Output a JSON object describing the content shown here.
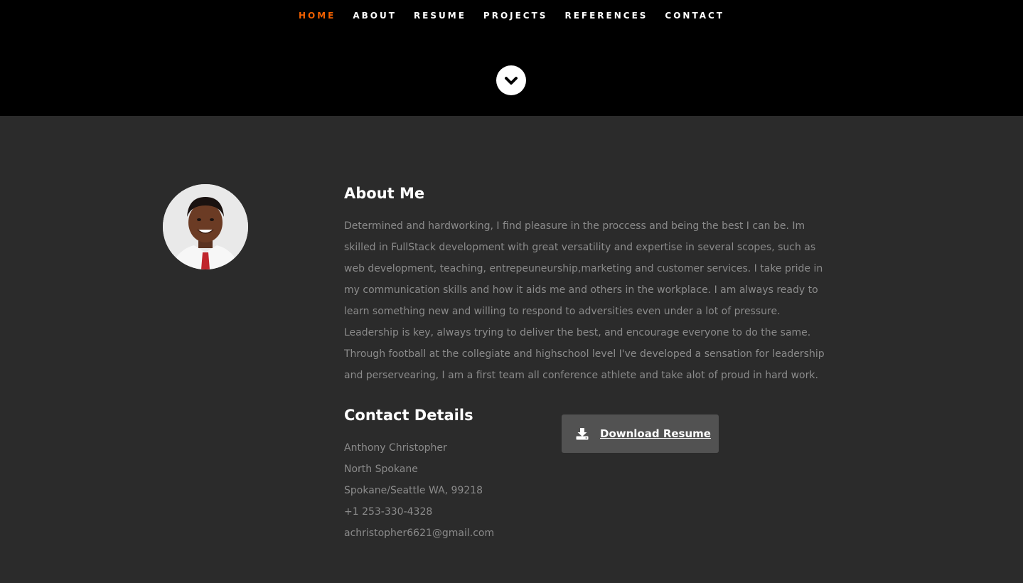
{
  "nav": {
    "items": [
      {
        "label": "HOME",
        "active": true
      },
      {
        "label": "ABOUT"
      },
      {
        "label": "RESUME"
      },
      {
        "label": "PROJECTS"
      },
      {
        "label": "REFERENCES"
      },
      {
        "label": "CONTACT"
      }
    ],
    "active_color": "#f06000"
  },
  "hero": {
    "scroll_icon": "chevron-down-circle-icon"
  },
  "about": {
    "title": "About Me",
    "bio": "Determined and hardworking, I find pleasure in the proccess and being the best I can be. Im skilled in FullStack development with great versatility and expertise in several scopes, such as web development, teaching, entrepeuneurship,marketing and customer services. I take pride in my communication skills and how it aids me and others in the workplace. I am always ready to learn something new and willing to respond to adversities even under a lot of pressure. Leadership is key, always trying to deliver the best, and encourage everyone to do the same. Through football at the collegiate and highschool level I've developed a sensation for leadership and perservearing, I am a first team all conference athlete and take alot of proud in hard work."
  },
  "contact": {
    "title": "Contact Details",
    "name": "Anthony Christopher",
    "address1": "North Spokane",
    "address2": "Spokane/Seattle WA, 99218",
    "phone": "+1 253-330-4328",
    "email": "achristopher6621@gmail.com"
  },
  "download": {
    "label": "Download Resume",
    "icon": "download-icon"
  }
}
